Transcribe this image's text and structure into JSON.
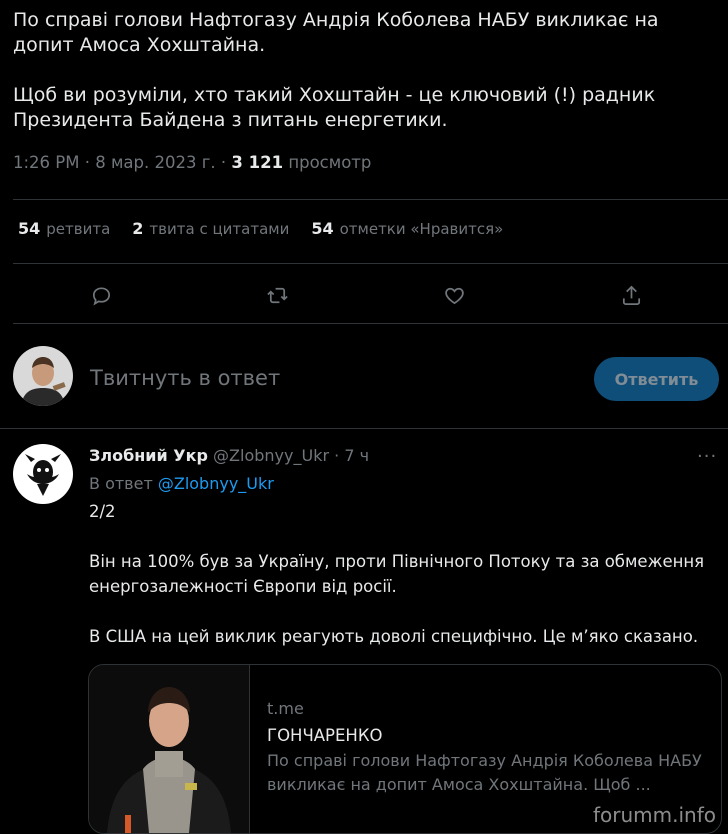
{
  "tweet": {
    "text": "По справі голови Нафтогазу Андрія Коболева НАБУ викликає на допит Амоса Хохштайна.\n\nЩоб ви розуміли, хто такий Хохштайн - це ключовий (!) радник Президента Байдена з питань енергетики.",
    "time": "1:26 PM",
    "date": "8 мар. 2023 г.",
    "views_count": "3 121",
    "views_label": "просмотр"
  },
  "stats": [
    {
      "count": "54",
      "label": "ретвита"
    },
    {
      "count": "2",
      "label": "твита с цитатами"
    },
    {
      "count": "54",
      "label": "отметки «Нравится»"
    }
  ],
  "actions": {
    "icons": [
      "reply-icon",
      "retweet-icon",
      "like-icon",
      "share-icon"
    ]
  },
  "composer": {
    "placeholder": "Твитнуть в ответ",
    "button": "Ответить"
  },
  "reply": {
    "display_name": "Злобний Укр",
    "handle": "@Zlobnyy_Ukr",
    "dot": "·",
    "time": "7 ч",
    "replying_prefix": "В ответ",
    "replying_handle": "@Zlobnyy_Ukr",
    "text": "2/2\n\nВін на 100% був за Україну, проти Північного Потоку та за обмеження енергозалежності Європи від росії.\n\nВ США на цей виклик реагують доволі специфічно. Це м’яко сказано.",
    "more": "···"
  },
  "card": {
    "domain": "t.me",
    "title": "ГОНЧАРЕНКО",
    "description": "По справі голови Нафтогазу Андрія Коболева НАБУ викликає на допит Амоса Хохштайна. Щоб ..."
  },
  "watermark": "forumm.info",
  "colors": {
    "background": "#000000",
    "text": "#e7e9ea",
    "muted": "#71767b",
    "link": "#1d9bf0",
    "button": "#0f4e78",
    "border": "#2f3336"
  }
}
